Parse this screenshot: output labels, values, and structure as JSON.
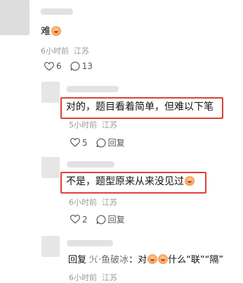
{
  "comments": [
    {
      "text": "难",
      "time": "6小时前",
      "location": "江苏",
      "likes": "6",
      "replies_count": "13"
    },
    {
      "text": "对的，题目看着简单，但难以下笔",
      "time": "5小时前",
      "location": "江苏",
      "likes": "5",
      "reply_label": "回复"
    },
    {
      "text": "不是，题型原来从来没见过",
      "time": "6小时前",
      "location": "江苏",
      "likes": "2",
      "reply_label": "回复"
    },
    {
      "prefix": "回复",
      "target": "ℋ·鱼破冰",
      "text_a": "：对",
      "text_b": "什么“联”“隔”",
      "time": "6小时前",
      "location": "江苏"
    }
  ],
  "icons": {
    "like": "heart-outline-icon",
    "comment": "comment-bubble-icon",
    "emoji": "crying-face-emoji"
  },
  "colors": {
    "highlight_border": "#e0403b",
    "meta_text": "#9a9a9a"
  }
}
